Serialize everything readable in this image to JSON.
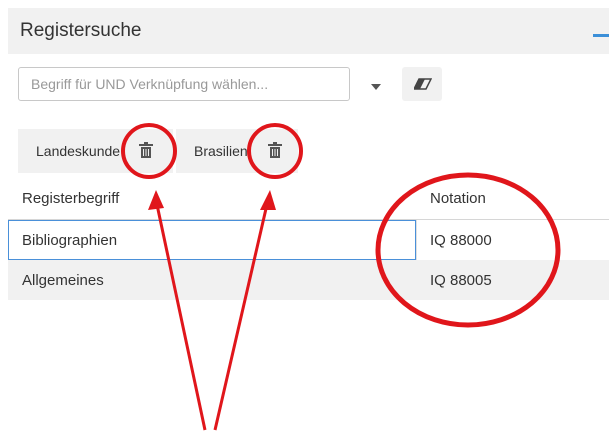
{
  "panel": {
    "title": "Registersuche"
  },
  "search": {
    "placeholder": "Begriff für UND Verknüpfung wählen..."
  },
  "tags": [
    {
      "label": "Landeskunde"
    },
    {
      "label": "Brasilien"
    }
  ],
  "table": {
    "columns": [
      "Registerbegriff",
      "Notation"
    ],
    "rows": [
      {
        "term": "Bibliographien",
        "notation": "IQ 88000"
      },
      {
        "term": "Allgemeines",
        "notation": "IQ 88005"
      }
    ]
  },
  "colors": {
    "accent": "#3b8fd8",
    "annotation": "#e0161b",
    "panel_bg": "#f1f1f1"
  },
  "icons": [
    "minimize-icon",
    "chevron-down-icon",
    "eraser-icon",
    "trash-icon"
  ]
}
